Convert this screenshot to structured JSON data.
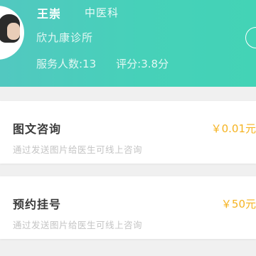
{
  "header": {
    "doctor_name": "王崇",
    "department": "中医科",
    "clinic": "欣九康诊所",
    "service_count": "服务人数:13",
    "rating": "评分:3.8分"
  },
  "services": [
    {
      "title": "图文咨询",
      "description": "通过发送图片给医生可线上咨询",
      "price": "￥0.01元"
    },
    {
      "title": "预约挂号",
      "description": "通过发送图片给医生可线上咨询",
      "price": "￥50元"
    }
  ],
  "colors": {
    "header_gradient_start": "#52c8c0",
    "header_gradient_end": "#43d3b6",
    "price": "#f5b321",
    "title": "#3a3a3a",
    "description": "#c4c4c4",
    "background": "#f0f0f0"
  }
}
